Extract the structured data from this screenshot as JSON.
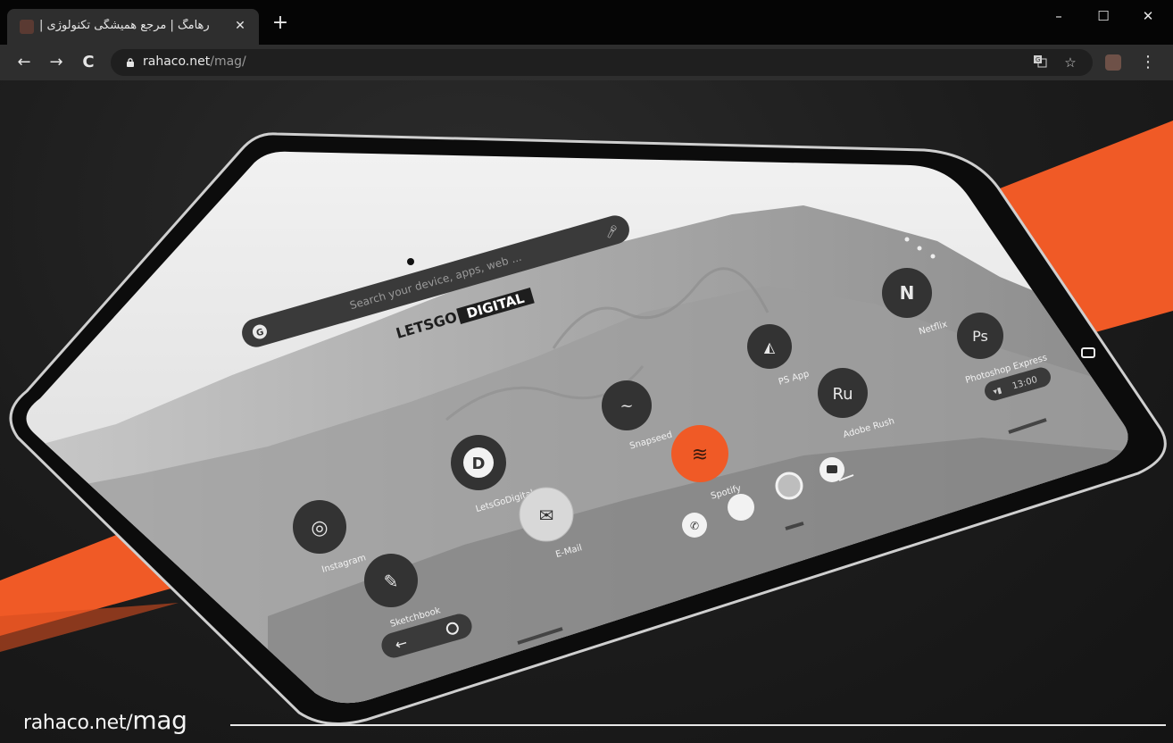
{
  "browser": {
    "tab_title": "رهامگ | مرجع همیشگی تکنولوژی |",
    "tab_close": "✕",
    "new_tab": "+",
    "window_controls": {
      "minimize": "–",
      "maximize": "☐",
      "close": "✕"
    },
    "nav": {
      "back": "←",
      "forward": "→",
      "reload": "C"
    },
    "url_host": "rahaco.net",
    "url_path": "/mag/",
    "icons": [
      "lock-icon",
      "translate-icon",
      "star-icon",
      "extension-icon",
      "menu-icon"
    ]
  },
  "tablet": {
    "brand_logo": {
      "part1": "LETSGO",
      "part2": "DIGITAL"
    },
    "search_placeholder": "Search your device, apps, web ...",
    "search_g": "G",
    "apps": [
      {
        "name": "Netflix",
        "glyph": "N"
      },
      {
        "name": "Photoshop Express",
        "glyph": "Ps"
      },
      {
        "name": "PS App",
        "glyph": "◭"
      },
      {
        "name": "Adobe Rush",
        "glyph": "Ru"
      },
      {
        "name": "Snapseed",
        "glyph": "~"
      },
      {
        "name": "Spotify",
        "glyph": "≋"
      },
      {
        "name": "LetsGoDigital",
        "glyph": "D"
      },
      {
        "name": "E-Mail",
        "glyph": "✉"
      },
      {
        "name": "Instagram",
        "glyph": "◎"
      },
      {
        "name": "Sketchbook",
        "glyph": "✎"
      }
    ],
    "status_time": "13:00",
    "dock_icons": [
      "phone-icon",
      "chat-icon",
      "chrome-icon",
      "camera-icon"
    ],
    "colors": {
      "accent": "#f05a26",
      "screen_bg": "#d9d9d9",
      "bezel": "#0c0c0c"
    }
  },
  "watermark": {
    "host": "rahaco.net/",
    "path": "mag"
  }
}
